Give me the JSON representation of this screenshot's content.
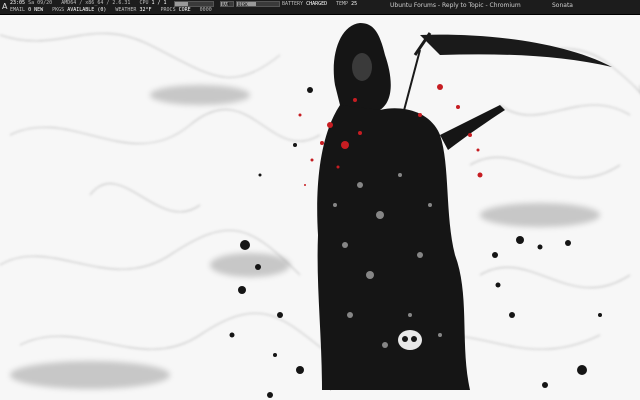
{
  "panel": {
    "logo_glyph": "A",
    "row1": {
      "time": "23:05",
      "day": "Sa",
      "date": "09/20",
      "info": "AMD64 / x86_64 / 2.6.31",
      "cpu_label": "CPU",
      "cpu_value": "1 / 1",
      "ram_label": "RAM",
      "disk_label": "DISK",
      "battery_label": "BATTERY",
      "battery_value": "CHARGED",
      "temp_label": "TEMP",
      "temp_value": "25"
    },
    "row2": {
      "mail_label": "EMAIL",
      "mail_value": "0 NEW",
      "pkg_label": "PKGS",
      "pkg_value": "AVAILABLE (0)",
      "weather_label": "WEATHER",
      "weather_value": "32°F",
      "procs_label": "PROCS",
      "procs_value": "CORE",
      "net_value": "0000"
    },
    "bars": {
      "cpu_level": 0.35,
      "ram_level": 0.55,
      "disk_level": 0.45
    },
    "window_title": "Ubuntu Forums - Reply to Topic - Chromium",
    "second_window": "Sonata"
  },
  "wallpaper": {
    "colors": {
      "ink": "#141414",
      "blood": "#c61d22",
      "mist": "#9a9a9a",
      "bg": "#f7f7f7"
    }
  }
}
